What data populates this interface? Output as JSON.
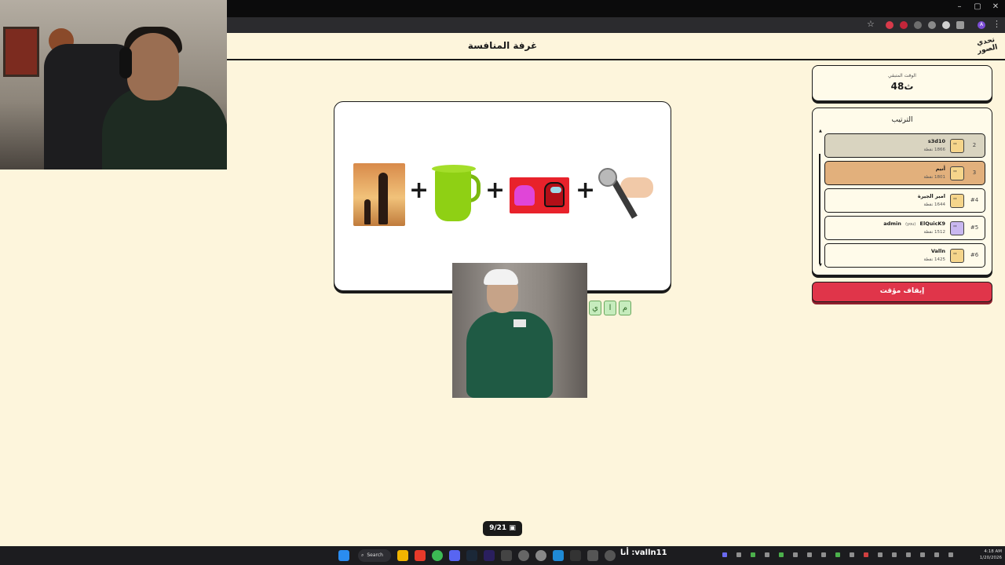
{
  "header": {
    "title": "غرفة المنافسة",
    "logo_text": "تحدي الصور"
  },
  "browser": {
    "minimize": "–",
    "maximize": "▢",
    "close": "✕",
    "bookmark": "☆",
    "profile": "A",
    "menu": "⋮"
  },
  "puzzle": {
    "images": [
      "sunset-silhouette",
      "green-pitcher",
      "among-us-impostor",
      "microphone-hand"
    ],
    "plus": "+",
    "answer_letters": [
      "ي",
      "ا",
      "م"
    ]
  },
  "timer": {
    "label": "الوقت المتبقي",
    "value": "48ث"
  },
  "ranking": {
    "title": "الترتيب",
    "scroll_up": "▲",
    "scroll_down": "▼",
    "rows": [
      {
        "rank": "2",
        "name": "s3d10",
        "points": "1866 نقطة",
        "color": "#d9d4c0"
      },
      {
        "rank": "3",
        "name": "أنيم",
        "points": "1801 نقطة",
        "color": "#e2b07c"
      },
      {
        "rank": "#4",
        "name": "امير الجيرة",
        "points": "1644 نقطة",
        "color": "#fffbea"
      },
      {
        "rank": "#5",
        "name": "ElQuicK9",
        "you": "(you)",
        "role": "admin",
        "points": "1512 نقطة",
        "color": "#fffbea"
      },
      {
        "rank": "#6",
        "name": "Valln",
        "points": "1425 نقطة",
        "color": "#fffbea"
      }
    ]
  },
  "controls": {
    "pause_label": "إيقاف مؤقت"
  },
  "pagination": {
    "counter": "9/21"
  },
  "taskbar": {
    "search_label": "Search",
    "stream_text": "أنا :valln11",
    "time": "4:18 AM",
    "date": "1/20/2026"
  },
  "colors": {
    "page_bg": "#fdf5dc",
    "accent_red": "#e0354a",
    "correct_green": "#c6ecbd"
  }
}
